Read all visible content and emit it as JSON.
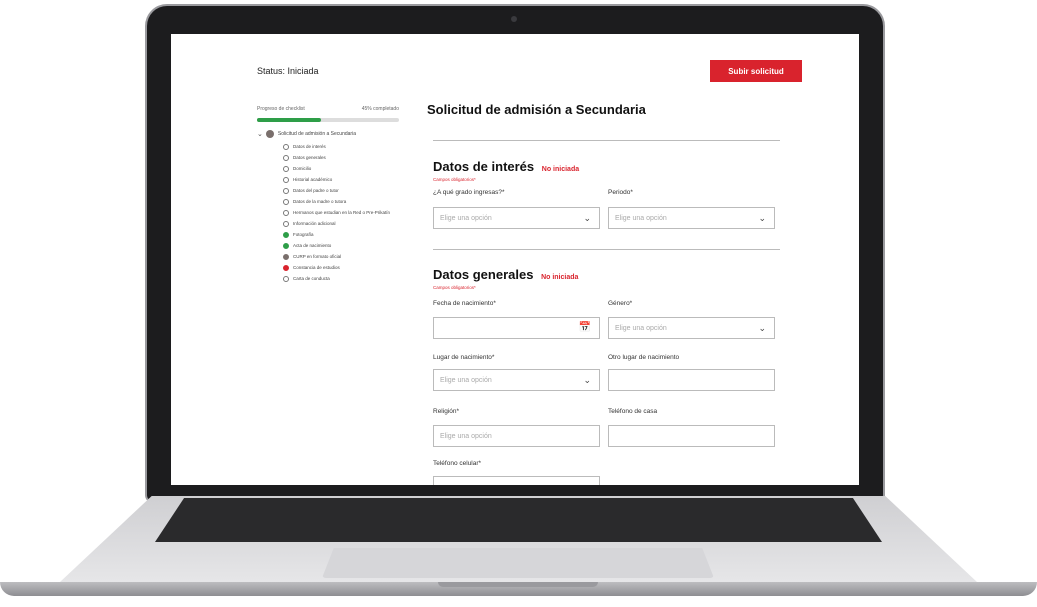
{
  "header": {
    "status": "Status: Iniciada",
    "submit_label": "Subir solicitud"
  },
  "sidebar": {
    "progress_label": "Progreso de checklist",
    "progress_value": "45% completado",
    "progress_fraction": 0.45,
    "root_label": "Solicitud de admisión a Secundaria",
    "items": [
      {
        "label": "Datos de interés",
        "state": "empty"
      },
      {
        "label": "Datos generales",
        "state": "empty"
      },
      {
        "label": "Domicilio",
        "state": "empty"
      },
      {
        "label": "Historial académico",
        "state": "empty"
      },
      {
        "label": "Datos del padre o tutor",
        "state": "empty"
      },
      {
        "label": "Datos de la madre o tutora",
        "state": "empty"
      },
      {
        "label": "Hermanos que estudian en la Red o Pre-Prikatín",
        "state": "empty"
      },
      {
        "label": "Información adicional",
        "state": "empty"
      },
      {
        "label": "Fotografía",
        "state": "ok"
      },
      {
        "label": "Acta de nacimiento",
        "state": "ok"
      },
      {
        "label": "CURP en formato oficial",
        "state": "warn"
      },
      {
        "label": "Constancia de estudios",
        "state": "err"
      },
      {
        "label": "Carta de conducta",
        "state": "empty"
      }
    ]
  },
  "main": {
    "title": "Solicitud de admisión a Secundaria",
    "section1": {
      "title": "Datos de interés",
      "badge": "No iniciada",
      "sub": "Campos obligatorios*",
      "grade_label": "¿A qué grado ingresas?*",
      "grade_placeholder": "Elige una opción",
      "period_label": "Periodo*",
      "period_placeholder": "Elige una opción"
    },
    "section2": {
      "title": "Datos generales",
      "badge": "No iniciada",
      "sub": "Campos obligatorios*",
      "birthdate_label": "Fecha de nacimiento*",
      "gender_label": "Género*",
      "gender_placeholder": "Elige una opción",
      "birthplace_label": "Lugar de nacimiento*",
      "birthplace_placeholder": "Elige una opción",
      "other_birthplace_label": "Otro lugar de nacimiento",
      "religion_label": "Religión*",
      "religion_placeholder": "Elige una opción",
      "home_phone_label": "Teléfono de casa",
      "cell_phone_label": "Teléfono celular*"
    }
  },
  "colors": {
    "accent": "#d9232d",
    "success": "#2e9e48"
  }
}
